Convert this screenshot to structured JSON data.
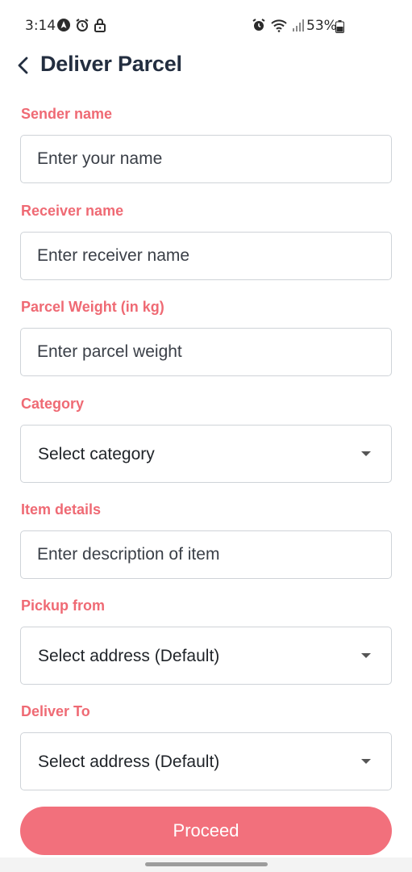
{
  "status_bar": {
    "time": "3:14",
    "battery_percent": "53%",
    "left_icons": [
      "navigation-icon",
      "alarm-icon",
      "lock-icon"
    ],
    "right_icons": [
      "alarm-icon",
      "wifi-icon",
      "signal-icon",
      "battery-icon"
    ]
  },
  "header": {
    "title": "Deliver Parcel",
    "back_icon": "chevron-left-icon"
  },
  "form": {
    "sender": {
      "label": "Sender name",
      "placeholder": "Enter your name"
    },
    "receiver": {
      "label": "Receiver name",
      "placeholder": "Enter receiver name"
    },
    "weight": {
      "label": "Parcel Weight (in kg)",
      "placeholder": "Enter parcel weight"
    },
    "category": {
      "label": "Category",
      "value": "Select category"
    },
    "item": {
      "label": "Item details",
      "placeholder": "Enter description of item"
    },
    "pickup": {
      "label": "Pickup from",
      "value": "Select address (Default)"
    },
    "deliver": {
      "label": "Deliver To",
      "value": "Select address (Default)"
    }
  },
  "proceed_label": "Proceed",
  "colors": {
    "accent": "#f2707c",
    "label": "#ef6a74",
    "title": "#232e40",
    "border": "#cfd3d8"
  }
}
